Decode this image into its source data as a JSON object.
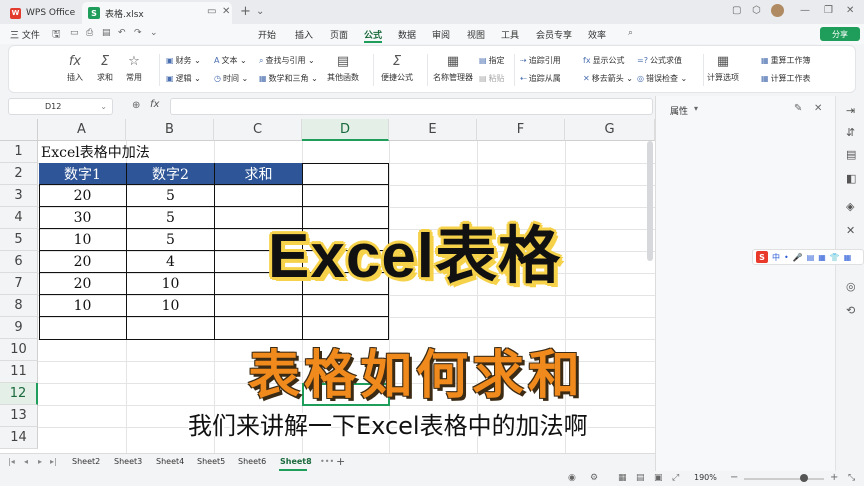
{
  "titlebar": {
    "tabs": [
      {
        "label": "WPS Office"
      },
      {
        "label": "表格.xlsx"
      }
    ],
    "new_tab": "+"
  },
  "menubar": {
    "file": "三 文件",
    "items": [
      "开始",
      "插入",
      "页面",
      "公式",
      "数据",
      "审阅",
      "视图",
      "工具",
      "会员专享",
      "效率"
    ],
    "active": "公式",
    "share": "分享"
  },
  "ribbon": {
    "big": [
      {
        "label": "插入",
        "icon": "fx"
      },
      {
        "label": "求和",
        "icon": "Σ"
      },
      {
        "label": "常用",
        "icon": "☆"
      },
      {
        "label": "其他函数",
        "icon": "▤"
      },
      {
        "label": "便捷公式",
        "icon": "Σ"
      },
      {
        "label": "名称管理器",
        "icon": "▦"
      }
    ],
    "small": [
      "财务",
      "逻辑",
      "文本",
      "时间",
      "查找与引用",
      "数学和三角",
      "指定",
      "粘贴",
      "追踪引用",
      "追踪从属",
      "显示公式",
      "移去箭头",
      "公式求值",
      "错误检查",
      "计算选项",
      "重算工作簿",
      "计算工作表"
    ]
  },
  "formula": {
    "cell_ref": "D12",
    "fx": "fx"
  },
  "sheet": {
    "columns": [
      "A",
      "B",
      "C",
      "D",
      "E",
      "F",
      "G"
    ],
    "selected_col": "D",
    "selected_row": "12",
    "rows": [
      "1",
      "2",
      "3",
      "4",
      "5",
      "6",
      "7",
      "8",
      "9",
      "10",
      "11",
      "12",
      "13",
      "14"
    ],
    "title": "Excel表格中加法",
    "headers": [
      "数字1",
      "数字2",
      "求和"
    ],
    "data": [
      [
        "20",
        "5"
      ],
      [
        "30",
        "5"
      ],
      [
        "10",
        "5"
      ],
      [
        "20",
        "4"
      ],
      [
        "20",
        "10"
      ],
      [
        "10",
        "10"
      ]
    ]
  },
  "sheettabs": {
    "tabs": [
      "Sheet2",
      "Sheet3",
      "Sheet4",
      "Sheet5",
      "Sheet6",
      "Sheet8"
    ],
    "active": "Sheet8",
    "add": "+"
  },
  "status": {
    "zoom": "190%"
  },
  "sidepanel": {
    "title": "属性"
  },
  "ime": {
    "logo": "S",
    "items": [
      "中",
      "•",
      "🎤",
      "▤",
      "▦",
      "👕",
      "▦"
    ]
  },
  "overlay": {
    "title": "Excel表格",
    "subtitle": "表格如何求和",
    "caption": "我们来讲解一下Excel表格中的加法啊"
  },
  "colors": {
    "accent": "#1e9e5a",
    "header_fill": "#2e5597",
    "title_stroke": "#f6d24a",
    "sub_fill": "#f08a1c"
  }
}
